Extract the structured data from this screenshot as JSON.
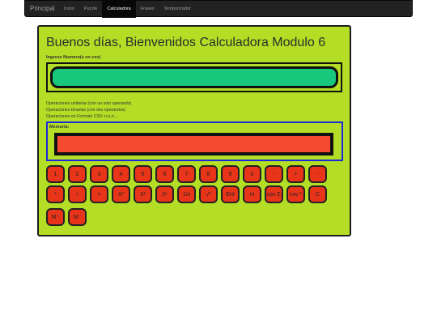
{
  "navbar": {
    "brand": "Principal",
    "links": [
      {
        "label": "Inicio"
      },
      {
        "label": "Puzzle"
      },
      {
        "label": "Calculadora"
      },
      {
        "label": "Frases"
      },
      {
        "label": "Temporizador"
      }
    ]
  },
  "main": {
    "title": "Buenos días, Bienvenidos Calculadora Modulo 6",
    "input_label": "Ingrese Numero(s en csv)",
    "input_value": "",
    "info": [
      "Operaciones unitarias (con un solo operando)",
      "Operaciones binarias (con dos operandos)",
      "Operaciones en Formato CSV: n,n,n..."
    ],
    "memory_label": "Memoria:",
    "memory_value": "",
    "keys_row1": [
      "1",
      "2",
      "3",
      "4",
      "5",
      "6",
      "7",
      "8",
      "9",
      "0",
      "-",
      "+",
      "-"
    ],
    "keys_row2": [
      "*",
      "/",
      "=",
      "X³",
      "X²",
      "2ⁿ",
      "1/x",
      "√²",
      "Ent",
      "n!",
      "csv Σ",
      "csv *",
      "C"
    ],
    "keys_row3": [
      "M⁺",
      "M⁻"
    ]
  },
  "colors": {
    "panel_bg": "#b3de25",
    "input_bg": "#17c77c",
    "memory_bg": "#f44a30",
    "key_bg": "#e8351a",
    "navbar_bg": "#222222"
  }
}
